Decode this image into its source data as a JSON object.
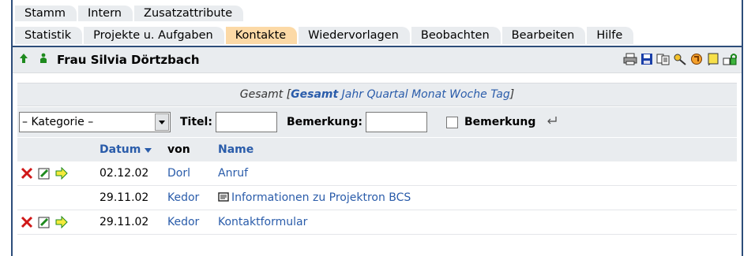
{
  "tabs_row1": [
    "Stamm",
    "Intern",
    "Zusatzattribute"
  ],
  "tabs_row2": [
    "Statistik",
    "Projekte u. Aufgaben",
    "Kontakte",
    "Wiedervorlagen",
    "Beobachten",
    "Bearbeiten",
    "Hilfe"
  ],
  "active_tab": "Kontakte",
  "title": "Frau Silvia Dörtzbach",
  "period": {
    "prefix": "Gesamt [",
    "options": [
      "Gesamt",
      "Jahr",
      "Quartal",
      "Monat",
      "Woche",
      "Tag"
    ],
    "selected": "Gesamt",
    "suffix": "]"
  },
  "filter": {
    "category_value": "– Kategorie –",
    "title_label": "Titel:",
    "remark_label": "Bemerkung:",
    "checkbox_label": "Bemerkung"
  },
  "table": {
    "headers": {
      "date": "Datum",
      "from": "von",
      "name": "Name"
    },
    "rows": [
      {
        "date": "02.12.02",
        "from": "Dorl",
        "name": "Anruf",
        "actions": true,
        "doc_icon": false
      },
      {
        "date": "29.11.02",
        "from": "Kedor",
        "name": "Informationen zu Projektron BCS",
        "actions": false,
        "doc_icon": true
      },
      {
        "date": "29.11.02",
        "from": "Kedor",
        "name": "Kontaktformular",
        "actions": true,
        "doc_icon": false
      }
    ]
  },
  "colors": {
    "active_tab": "#fcd9a6",
    "tab": "#e9ecef",
    "link": "#2a5caa",
    "frame": "#2d4d7a"
  }
}
